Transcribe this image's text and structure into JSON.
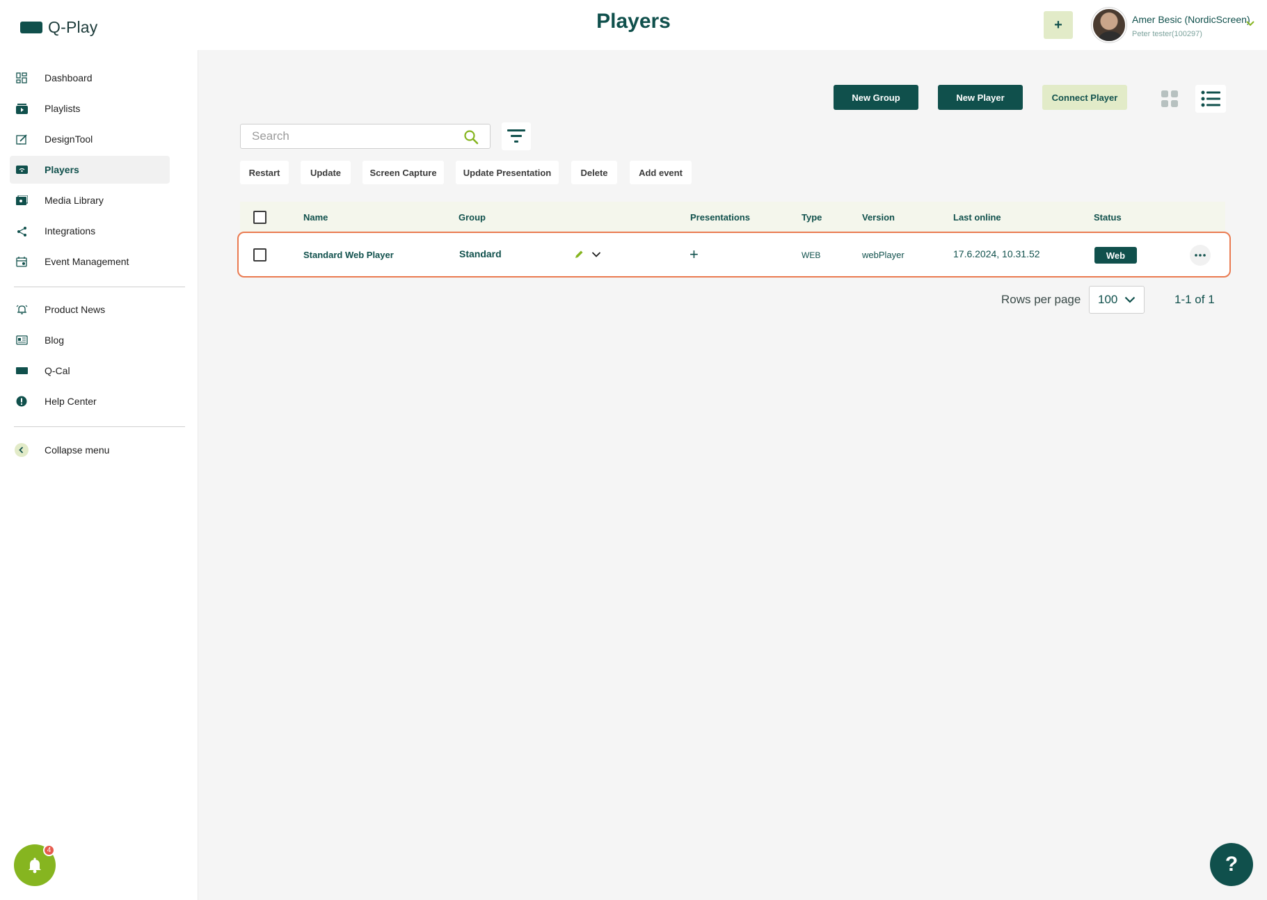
{
  "app": {
    "logo_text": "Q-Play",
    "page_title": "Players"
  },
  "header": {
    "add_label": "+",
    "user_name": "Amer Besic (NordicScreen)",
    "user_sub": "Peter tester(100297)"
  },
  "sidebar": {
    "items": [
      {
        "label": "Dashboard",
        "icon": "dashboard-icon"
      },
      {
        "label": "Playlists",
        "icon": "playlist-icon"
      },
      {
        "label": "DesignTool",
        "icon": "design-tool-icon"
      },
      {
        "label": "Players",
        "icon": "player-icon",
        "active": true
      },
      {
        "label": "Media Library",
        "icon": "media-library-icon"
      },
      {
        "label": "Integrations",
        "icon": "integrations-icon"
      },
      {
        "label": "Event Management",
        "icon": "calendar-icon"
      },
      {
        "label": "Product News",
        "icon": "news-bell-icon"
      },
      {
        "label": "Blog",
        "icon": "blog-icon"
      },
      {
        "label": "Q-Cal",
        "icon": "qcal-icon"
      },
      {
        "label": "Help Center",
        "icon": "help-center-icon"
      },
      {
        "label": "Collapse menu",
        "icon": "chevron-left-icon"
      }
    ],
    "notification_count": "4"
  },
  "toolbar": {
    "new_group": "New Group",
    "new_player": "New Player",
    "connect_player": "Connect Player",
    "view_mode": "list"
  },
  "search": {
    "placeholder": "Search",
    "value": ""
  },
  "actions": [
    "Restart",
    "Update",
    "Screen Capture",
    "Update Presentation",
    "Delete",
    "Add event"
  ],
  "table": {
    "columns": [
      "Name",
      "Group",
      "Presentations",
      "Type",
      "Version",
      "Last online",
      "Status"
    ],
    "rows": [
      {
        "name": "Standard Web Player",
        "group": "Standard",
        "presentations": "+",
        "type": "WEB",
        "version": "webPlayer",
        "last_online": "17.6.2024, 10.31.52",
        "status": "Web"
      }
    ]
  },
  "pagination": {
    "rows_per_page_label": "Rows per page",
    "rows_per_page": "100",
    "range": "1-1 of 1"
  },
  "help": {
    "label": "?"
  },
  "colors": {
    "primary": "#10504c",
    "accent": "#86b520",
    "light_accent": "#e2ebc8",
    "highlight": "#ea7a50"
  }
}
